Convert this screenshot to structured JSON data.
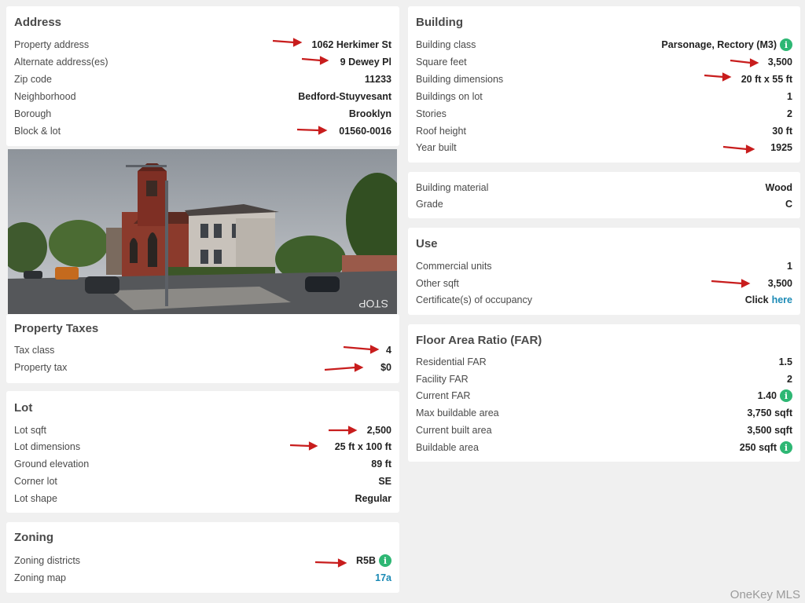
{
  "address": {
    "title": "Address",
    "rows": [
      {
        "label": "Property address",
        "value": "1062 Herkimer St"
      },
      {
        "label": "Alternate address(es)",
        "value": "9 Dewey Pl"
      },
      {
        "label": "Zip code",
        "value": "11233"
      },
      {
        "label": "Neighborhood",
        "value": "Bedford-Stuyvesant"
      },
      {
        "label": "Borough",
        "value": "Brooklyn"
      },
      {
        "label": "Block & lot",
        "value": "01560-0016"
      }
    ]
  },
  "taxes": {
    "title": "Property Taxes",
    "rows": [
      {
        "label": "Tax class",
        "value": "4"
      },
      {
        "label": "Property tax",
        "value": "$0"
      }
    ]
  },
  "lot": {
    "title": "Lot",
    "rows": [
      {
        "label": "Lot sqft",
        "value": "2,500"
      },
      {
        "label": "Lot dimensions",
        "value": "25 ft x 100 ft"
      },
      {
        "label": "Ground elevation",
        "value": "89 ft"
      },
      {
        "label": "Corner lot",
        "value": "SE"
      },
      {
        "label": "Lot shape",
        "value": "Regular"
      }
    ]
  },
  "zoning": {
    "title": "Zoning",
    "rows": [
      {
        "label": "Zoning districts",
        "value": "R5B"
      },
      {
        "label": "Zoning map",
        "value": "17a"
      }
    ]
  },
  "building": {
    "title": "Building",
    "rows": [
      {
        "label": "Building class",
        "value": "Parsonage, Rectory (M3)"
      },
      {
        "label": "Square feet",
        "value": "3,500"
      },
      {
        "label": "Building dimensions",
        "value": "20 ft x 55 ft"
      },
      {
        "label": "Buildings on lot",
        "value": "1"
      },
      {
        "label": "Stories",
        "value": "2"
      },
      {
        "label": "Roof height",
        "value": "30 ft"
      },
      {
        "label": "Year built",
        "value": "1925"
      }
    ]
  },
  "material": {
    "rows": [
      {
        "label": "Building material",
        "value": "Wood"
      },
      {
        "label": "Grade",
        "value": "C"
      }
    ]
  },
  "use": {
    "title": "Use",
    "rows": [
      {
        "label": "Commercial units",
        "value": "1"
      },
      {
        "label": "Other sqft",
        "value": "3,500"
      },
      {
        "label": "Certificate(s) of occupancy",
        "value_prefix": "Click",
        "value_link": "here"
      }
    ]
  },
  "far": {
    "title": "Floor Area Ratio (FAR)",
    "rows": [
      {
        "label": "Residential FAR",
        "value": "1.5"
      },
      {
        "label": "Facility FAR",
        "value": "2"
      },
      {
        "label": "Current FAR",
        "value": "1.40"
      },
      {
        "label": "Max buildable area",
        "value": "3,750 sqft"
      },
      {
        "label": "Current built area",
        "value": "3,500 sqft"
      },
      {
        "label": "Buildable area",
        "value": "250 sqft"
      }
    ]
  },
  "info_icon_glyph": "i",
  "watermark": "OneKey MLS",
  "colors": {
    "accent": "#2eb774",
    "link": "#1b8ab5",
    "arrow": "#c81d1d"
  }
}
